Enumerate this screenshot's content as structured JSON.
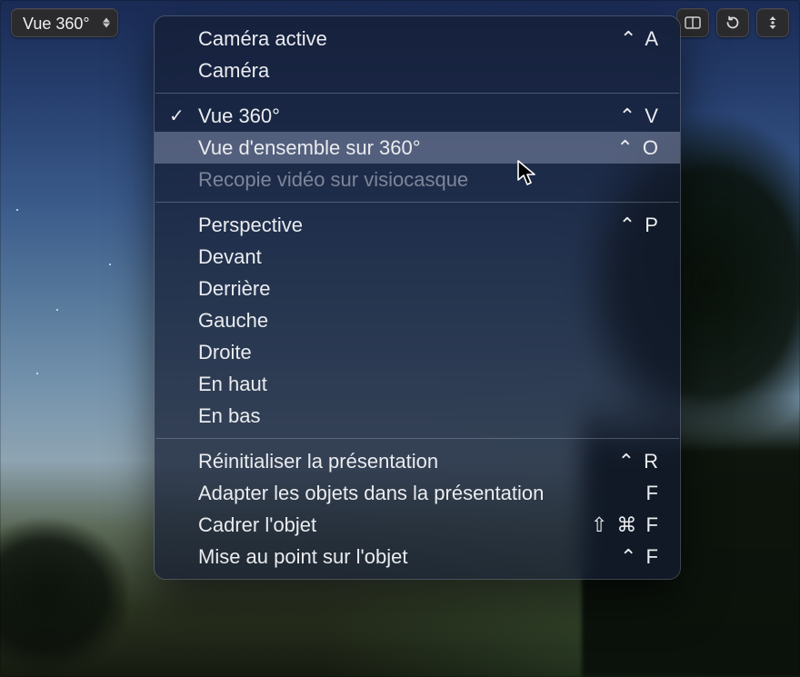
{
  "topbar": {
    "view_selector_label": "Vue 360°"
  },
  "menu": {
    "groups": [
      [
        {
          "label": "Caméra active",
          "shortcut": "⌃ A",
          "checked": false,
          "enabled": true,
          "hover": false
        },
        {
          "label": "Caméra",
          "shortcut": "",
          "checked": false,
          "enabled": true,
          "hover": false
        }
      ],
      [
        {
          "label": "Vue 360°",
          "shortcut": "⌃ V",
          "checked": true,
          "enabled": true,
          "hover": false
        },
        {
          "label": "Vue d'ensemble sur 360°",
          "shortcut": "⌃ O",
          "checked": false,
          "enabled": true,
          "hover": true
        },
        {
          "label": "Recopie vidéo sur visiocasque",
          "shortcut": "",
          "checked": false,
          "enabled": false,
          "hover": false
        }
      ],
      [
        {
          "label": "Perspective",
          "shortcut": "⌃ P",
          "checked": false,
          "enabled": true,
          "hover": false
        },
        {
          "label": "Devant",
          "shortcut": "",
          "checked": false,
          "enabled": true,
          "hover": false
        },
        {
          "label": "Derrière",
          "shortcut": "",
          "checked": false,
          "enabled": true,
          "hover": false
        },
        {
          "label": "Gauche",
          "shortcut": "",
          "checked": false,
          "enabled": true,
          "hover": false
        },
        {
          "label": "Droite",
          "shortcut": "",
          "checked": false,
          "enabled": true,
          "hover": false
        },
        {
          "label": "En haut",
          "shortcut": "",
          "checked": false,
          "enabled": true,
          "hover": false
        },
        {
          "label": "En bas",
          "shortcut": "",
          "checked": false,
          "enabled": true,
          "hover": false
        }
      ],
      [
        {
          "label": "Réinitialiser la présentation",
          "shortcut": "⌃ R",
          "checked": false,
          "enabled": true,
          "hover": false
        },
        {
          "label": "Adapter les objets dans la présentation",
          "shortcut": "F",
          "checked": false,
          "enabled": true,
          "hover": false
        },
        {
          "label": "Cadrer l'objet",
          "shortcut": "⇧ ⌘ F",
          "checked": false,
          "enabled": true,
          "hover": false
        },
        {
          "label": "Mise au point sur l'objet",
          "shortcut": "⌃ F",
          "checked": false,
          "enabled": true,
          "hover": false
        }
      ]
    ]
  }
}
